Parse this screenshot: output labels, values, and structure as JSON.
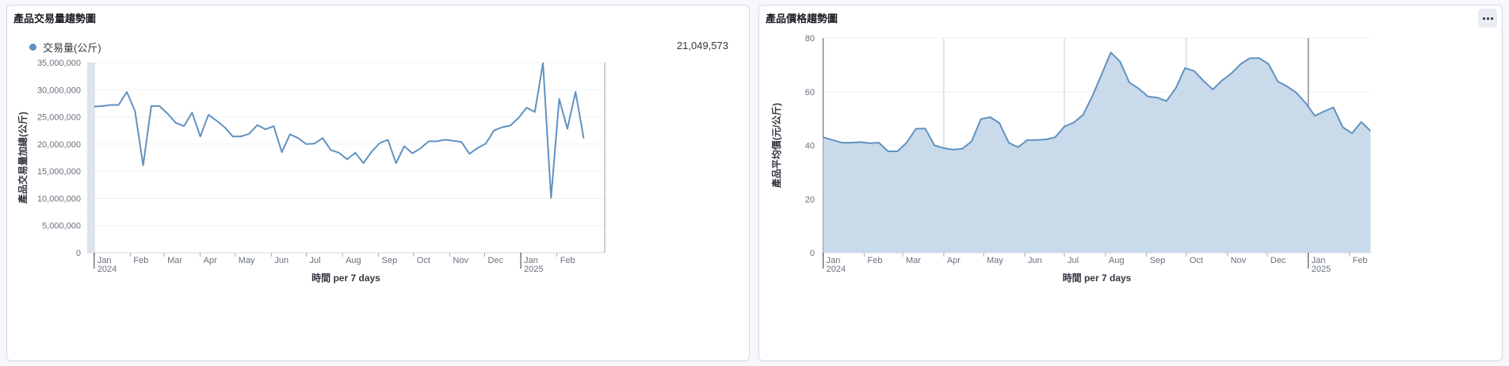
{
  "left_panel": {
    "title": "產品交易量趨勢圖",
    "legend": "交易量(公斤)",
    "metric": "21,049,573"
  },
  "right_panel": {
    "title": "產品價格趨勢圖",
    "options_icon": "ellipsis-icon"
  },
  "colors": {
    "series": "#6092c0",
    "area": "#c9daeb",
    "grid": "#eef0f3"
  },
  "chart_data": [
    {
      "type": "line",
      "xlabel": "時間 per 7 days",
      "ylabel": "產品交易量加總(公斤)",
      "ylim": [
        0,
        35000000
      ],
      "yticks": [
        "0",
        "5,000,000",
        "10,000,000",
        "15,000,000",
        "20,000,000",
        "25,000,000",
        "30,000,000",
        "35,000,000"
      ],
      "month_labels": [
        "Jan",
        "Feb",
        "Mar",
        "Apr",
        "May",
        "Jun",
        "Jul",
        "Aug",
        "Sep",
        "Oct",
        "Nov",
        "Dec",
        "Jan",
        "Feb"
      ],
      "year_labels": [
        "2024",
        "2025"
      ],
      "series": [
        {
          "name": "交易量(公斤)",
          "x_start": "2024-01-01",
          "values": [
            26900000,
            27000000,
            27200000,
            27200000,
            29600000,
            26100000,
            16100000,
            27000000,
            27000000,
            25600000,
            23900000,
            23300000,
            25800000,
            21400000,
            25400000,
            24300000,
            23100000,
            21400000,
            21400000,
            21900000,
            23500000,
            22700000,
            23300000,
            18500000,
            21800000,
            21100000,
            20000000,
            20100000,
            21100000,
            18900000,
            18400000,
            17200000,
            18400000,
            16500000,
            18600000,
            20200000,
            20800000,
            16500000,
            19600000,
            18300000,
            19200000,
            20500000,
            20500000,
            20800000,
            20600000,
            20400000,
            18200000,
            19300000,
            20100000,
            22500000,
            23100000,
            23400000,
            24800000,
            26700000,
            25900000,
            34900000,
            10100000,
            28300000,
            22800000,
            29600000,
            21049573
          ]
        }
      ]
    },
    {
      "type": "area",
      "xlabel": "時間 per 7 days",
      "ylabel": "產品平均價(元/公斤)",
      "ylim": [
        0,
        80
      ],
      "yticks": [
        "0",
        "20",
        "40",
        "60",
        "80"
      ],
      "month_labels": [
        "Jan",
        "Feb",
        "Mar",
        "Apr",
        "May",
        "Jun",
        "Jul",
        "Aug",
        "Sep",
        "Oct",
        "Nov",
        "Dec",
        "Jan",
        "Feb"
      ],
      "year_labels": [
        "2024",
        "2025"
      ],
      "series": [
        {
          "name": "產品平均價(元/公斤)",
          "x_start": "2024-01-01",
          "values": [
            43,
            42,
            41,
            41,
            41.2,
            40.8,
            41,
            37.8,
            37.8,
            41,
            46.2,
            46.3,
            40,
            39,
            38.4,
            38.8,
            41.5,
            49.8,
            50.5,
            48.3,
            41,
            39.3,
            42,
            42,
            42.2,
            43,
            47,
            48.5,
            51.3,
            58.2,
            66.4,
            74.6,
            71.2,
            63.4,
            61.2,
            58.2,
            57.8,
            56.5,
            61.3,
            68.8,
            67.7,
            64,
            60.8,
            64.2,
            66.8,
            70.3,
            72.5,
            72.5,
            70.3,
            63.8,
            62,
            59.6,
            55.8,
            51,
            52.7,
            54.1,
            46.8,
            44.5,
            48.7,
            45.4
          ]
        }
      ]
    }
  ]
}
